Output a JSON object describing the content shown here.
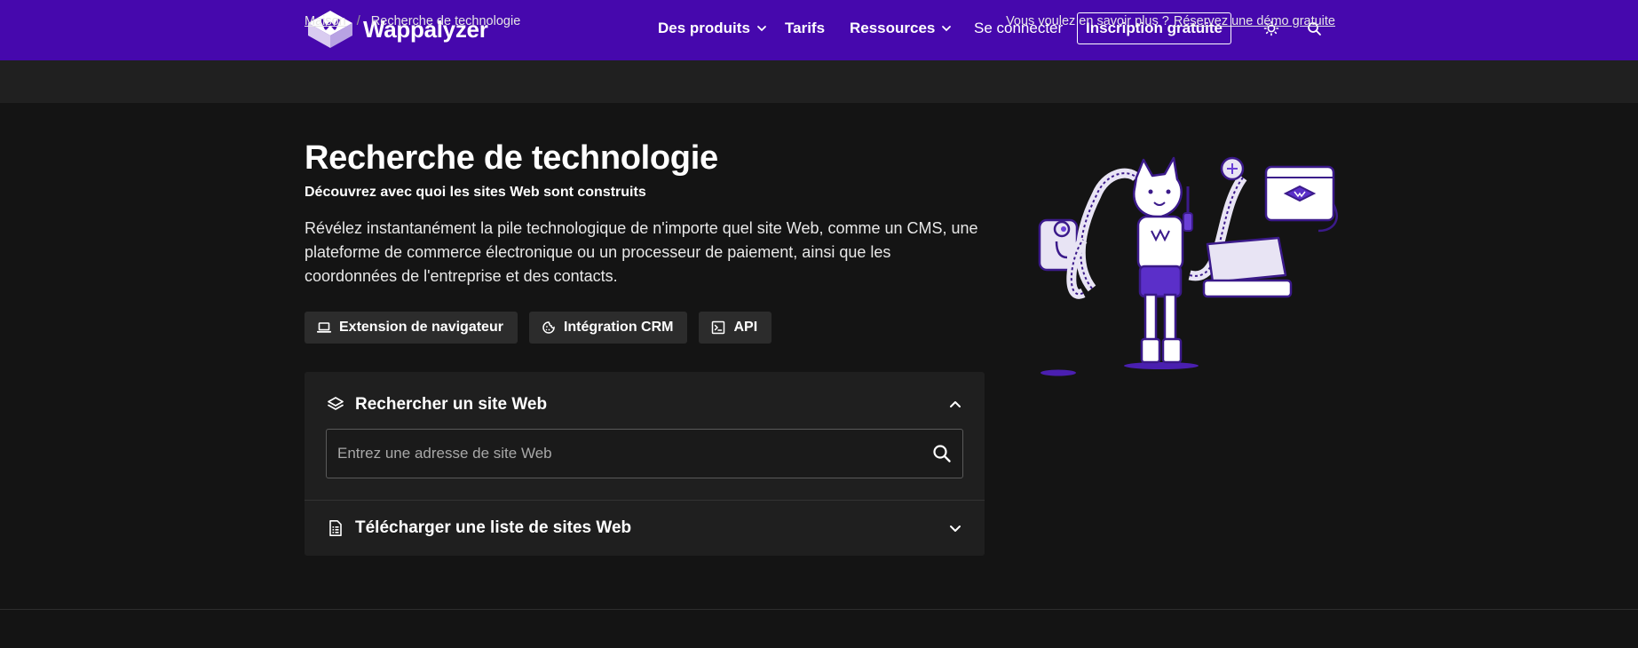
{
  "header": {
    "brand": "Wappalyzer",
    "nav": [
      {
        "label": "Des produits",
        "has_menu": true
      },
      {
        "label": "Tarifs",
        "has_menu": false
      },
      {
        "label": "Ressources",
        "has_menu": true
      },
      {
        "label": "Se connecter",
        "has_menu": false
      }
    ],
    "signup_label": "Inscription gratuite",
    "icons": [
      "sun-icon",
      "search-icon"
    ]
  },
  "breadcrumb": {
    "home": "Maison",
    "separator": "/",
    "current": "Recherche de technologie",
    "cta_text": "Vous voulez en savoir plus ?",
    "cta_link": "Réservez une démo gratuite"
  },
  "hero": {
    "title": "Recherche de technologie",
    "subtitle": "Découvrez avec quoi les sites Web sont construits",
    "description": "Révélez instantanément la pile technologique de n'importe quel site Web, comme un CMS, une plateforme de commerce électronique ou un processeur de paiement, ainsi que les coordonnées de l'entreprise et des contacts.",
    "chips": [
      {
        "label": "Extension de navigateur",
        "icon": "laptop-icon"
      },
      {
        "label": "Intégration CRM",
        "icon": "cookie-icon"
      },
      {
        "label": "API",
        "icon": "terminal-icon"
      }
    ]
  },
  "panel": {
    "search_section": {
      "label": "Rechercher un site Web",
      "icon": "layers-icon",
      "expanded": true,
      "input_placeholder": "Entrez une adresse de site Web",
      "input_value": ""
    },
    "upload_section": {
      "label": "Télécharger une liste de sites Web",
      "icon": "file-list-icon",
      "expanded": false
    }
  },
  "colors": {
    "brand": "#4608ad",
    "background": "#141414",
    "breadcrumb_bg": "#202020",
    "panel_bg": "#1f1f1f",
    "chip_bg": "#2c2c2c"
  }
}
